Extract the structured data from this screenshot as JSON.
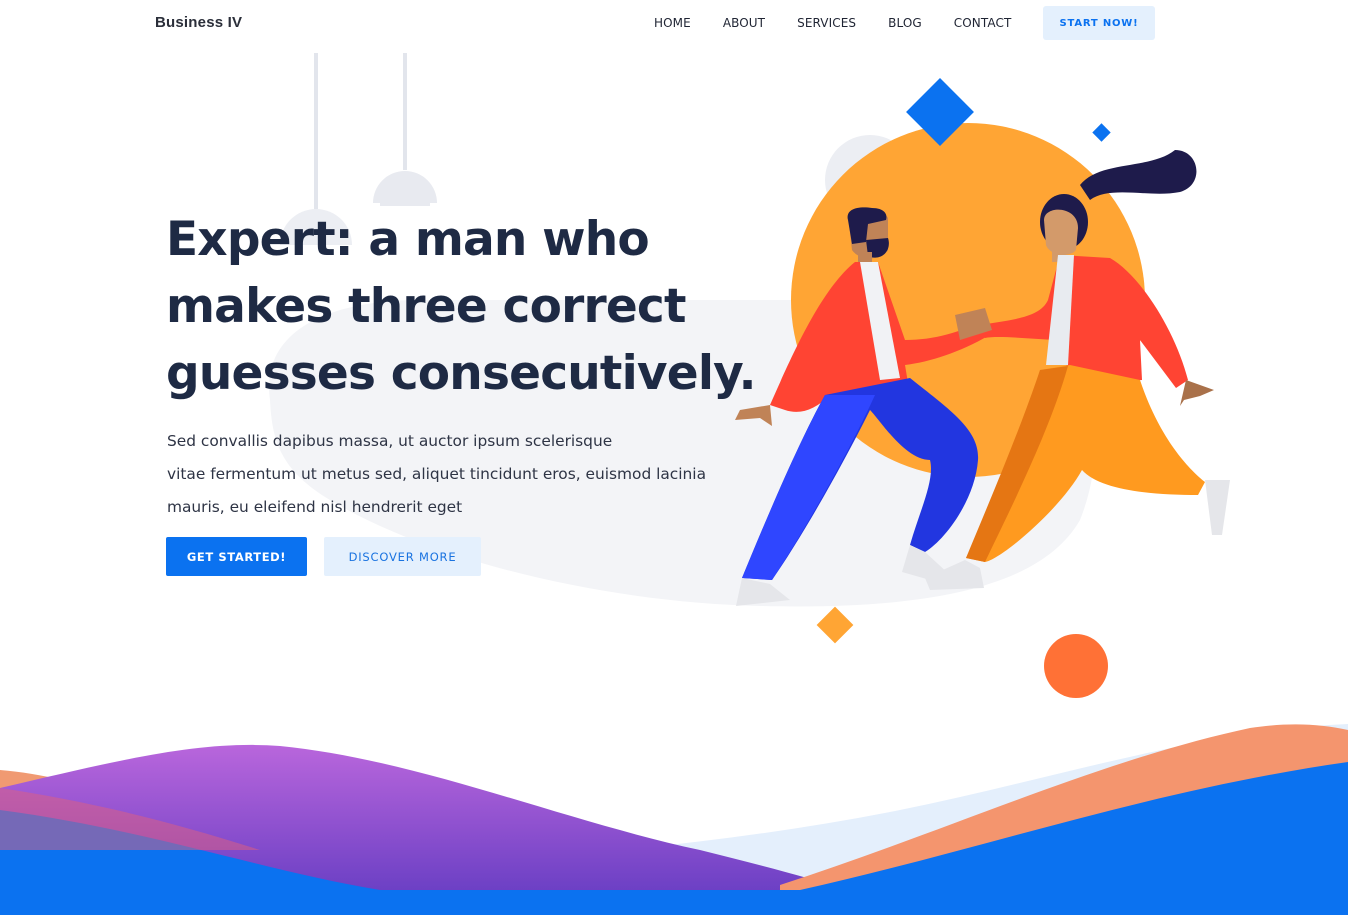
{
  "header": {
    "brand": "Business IV",
    "nav": [
      "HOME",
      "ABOUT",
      "SERVICES",
      "BLOG",
      "CONTACT"
    ],
    "cta": "START NOW!"
  },
  "hero": {
    "title_lines": [
      "Expert: a man who",
      "makes three correct",
      "guesses consecutively."
    ],
    "desc_lines": [
      "Sed convallis dapibus massa, ut auctor ipsum scelerisque",
      "vitae fermentum ut metus sed, aliquet tincidunt eros, euismod lacinia",
      "mauris, eu eleifend nisl hendrerit eget"
    ],
    "primary_button": "GET STARTED!",
    "secondary_button": "DISCOVER MORE"
  },
  "colors": {
    "primary": "#0b72f0",
    "primary_light": "#e4f0fd",
    "heading": "#1e2a44",
    "illustration_orange": "#ffa534",
    "illustration_red": "#ff4433",
    "wave_purple": "#9b59d6",
    "wave_peach": "#f4956e"
  },
  "icons": {
    "lamps": "pendant-lamp-icon",
    "people": "dancing-couple-illustration"
  }
}
